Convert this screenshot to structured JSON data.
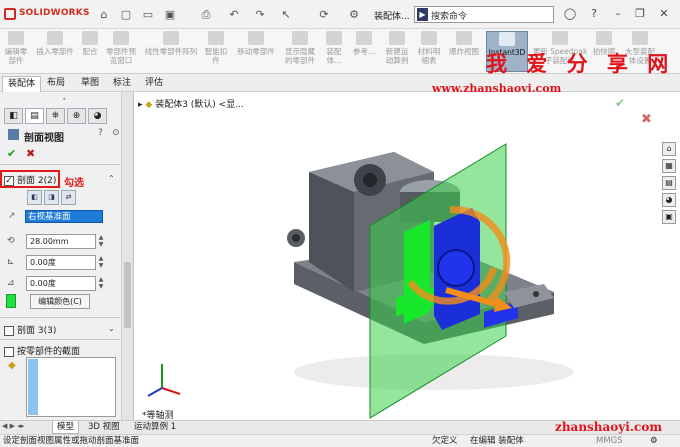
{
  "app": {
    "brand": "SOLIDWORKS",
    "doc_title": "装配体...",
    "search_placeholder": "搜索命令"
  },
  "toolbar_icons": [
    "home-icon",
    "new-file-icon",
    "open-icon",
    "save-icon",
    "print-icon",
    "undo-icon",
    "redo-icon",
    "select-icon",
    "rebuild-icon",
    "options-icon"
  ],
  "ribbon": [
    {
      "label1": "编辑零",
      "label2": "部件"
    },
    {
      "label1": "插入零部件",
      "label2": ""
    },
    {
      "label1": "配合",
      "label2": ""
    },
    {
      "label1": "零部件预",
      "label2": "览窗口"
    },
    {
      "label1": "线性零部件阵列",
      "label2": ""
    },
    {
      "label1": "智能扣",
      "label2": "件"
    },
    {
      "label1": "移动零部件",
      "label2": ""
    },
    {
      "label1": "显示隐藏",
      "label2": "的零部件"
    },
    {
      "label1": "装配体...",
      "label2": ""
    },
    {
      "label1": "参考...",
      "label2": ""
    },
    {
      "label1": "新建运",
      "label2": "动算例"
    },
    {
      "label1": "材料明",
      "label2": "细表"
    },
    {
      "label1": "爆炸视图",
      "label2": ""
    },
    {
      "label1": "Instant3D",
      "label2": ""
    },
    {
      "label1": "更新 Speedpak",
      "label2": "子装配体"
    },
    {
      "label1": "拍快照",
      "label2": ""
    },
    {
      "label1": "大型装配",
      "label2": "体设置"
    }
  ],
  "watermark": {
    "title": "我 爱 分 享 网",
    "url": "www.zhanshaoyi.com",
    "site": "zhanshaoyi.com"
  },
  "tabs": [
    "装配体",
    "布局",
    "草图",
    "标注",
    "评估"
  ],
  "panel": {
    "title": "剖面视图",
    "section1": {
      "label": "剖面 2(2)",
      "checked": true,
      "note": "勾选"
    },
    "plane": "右视基准面",
    "distance": "28.00mm",
    "angle1": "0.00度",
    "angle2": "0.00度",
    "edit_color": "编辑颜色(C)",
    "section2": {
      "label": "剖面 3(3)",
      "checked": false
    },
    "by_part": {
      "label": "按零部件的截面",
      "checked": false
    },
    "swatch_color": "#1FE03C"
  },
  "tree_root": "装配体3 (默认) <显...",
  "view_label": "*等轴测",
  "bottom_tabs": [
    "模型",
    "3D 视图",
    "运动算例 1"
  ],
  "status": {
    "hint": "设定剖面视图属性或拖动剖面基准面",
    "state1": "欠定义",
    "state2": "在编辑 装配体",
    "units": "MMGS"
  }
}
